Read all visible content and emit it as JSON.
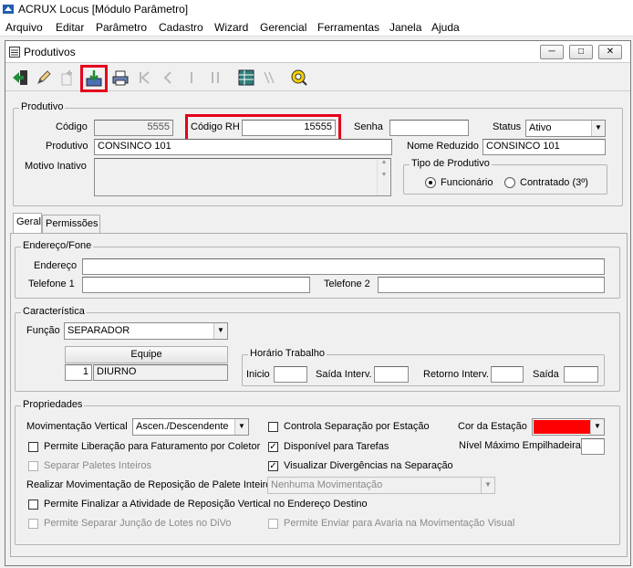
{
  "app": {
    "title": "ACRUX Locus [Módulo Parâmetro]"
  },
  "menu": [
    "Arquivo",
    "Editar",
    "Parâmetro",
    "Cadastro",
    "Wizard",
    "Gerencial",
    "Ferramentas",
    "Janela",
    "Ajuda"
  ],
  "window": {
    "title": "Produtivos"
  },
  "produto": {
    "group_label": "Produtivo",
    "codigo_label": "Código",
    "codigo_value": "5555",
    "codigo_rh_label": "Código RH",
    "codigo_rh_value": "15555",
    "senha_label": "Senha",
    "senha_value": "",
    "status_label": "Status",
    "status_value": "Ativo",
    "produtivo_label": "Produtivo",
    "produtivo_value": "CONSINCO 101",
    "nome_reduzido_label": "Nome Reduzido",
    "nome_reduzido_value": "CONSINCO 101",
    "motivo_inativo_label": "Motivo Inativo",
    "tipo_group_label": "Tipo de Produtivo",
    "tipo_funcionario": "Funcionário",
    "tipo_contratado": "Contratado (3º)",
    "tipo_selected": "funcionario"
  },
  "tabs": {
    "geral": "Geral",
    "permissoes": "Permissões"
  },
  "endereco": {
    "group_label": "Endereço/Fone",
    "endereco_label": "Endereço",
    "telefone1_label": "Telefone 1",
    "telefone2_label": "Telefone 2"
  },
  "caracteristica": {
    "group_label": "Característica",
    "funcao_label": "Função",
    "funcao_value": "SEPARADOR",
    "equipe_button": "Equipe",
    "equipe_num": "1",
    "equipe_name": "DIURNO",
    "horario_group_label": "Horário Trabalho",
    "inicio_label": "Inicio",
    "saida_interv_label": "Saída Interv.",
    "retorno_interv_label": "Retorno Interv.",
    "saida_label": "Saída"
  },
  "propriedades": {
    "group_label": "Propriedades",
    "mov_vertical_label": "Movimentação Vertical",
    "mov_vertical_value": "Ascen./Descendente",
    "controla_separacao": "Controla Separação por Estação",
    "cor_estacao_label": "Cor da Estação",
    "cor_estacao_color": "#ff0000",
    "permite_liberacao": "Permite Liberação para Faturamento por Coletor",
    "disponivel_tarefas": "Disponível para Tarefas",
    "nivel_max_label": "Nível Máximo Empilhadeira",
    "separar_paletes": "Separar Paletes Inteiros",
    "visualizar_divergencias": "Visualizar Divergências na Separação",
    "realizar_mov_label": "Realizar Movimentação de Reposição de Palete Inteiro",
    "realizar_mov_value": "Nenhuma Movimentação",
    "permite_finalizar": "Permite Finalizar a Atividade de Reposição Vertical no Endereço Destino",
    "permite_separar_juncao": "Permite Separar Junção de Lotes no DiVo",
    "permite_enviar_avaria": "Permite Enviar para Avaria na Movimentação Visual"
  },
  "colors": {
    "highlight": "#e4001b",
    "background": "#f0f0f0"
  }
}
